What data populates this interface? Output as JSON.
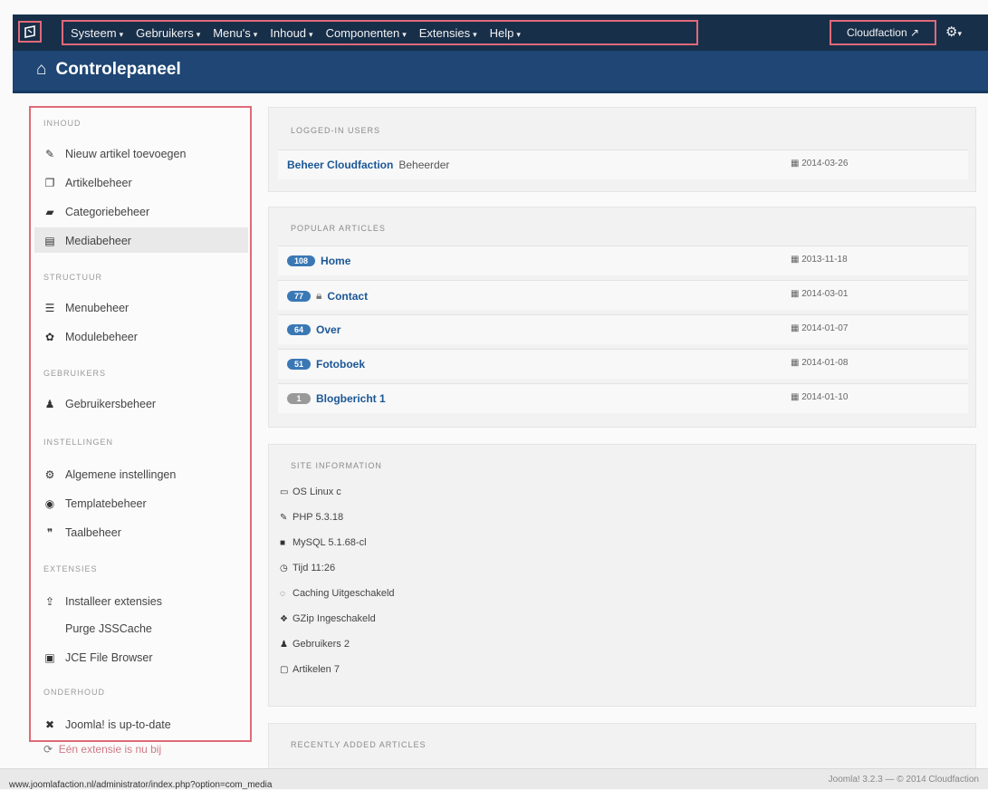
{
  "navbar": {
    "menu": [
      {
        "label": "Systeem"
      },
      {
        "label": "Gebruikers"
      },
      {
        "label": "Menu's"
      },
      {
        "label": "Inhoud"
      },
      {
        "label": "Componenten"
      },
      {
        "label": "Extensies"
      },
      {
        "label": "Help"
      }
    ],
    "site_link": "Cloudfaction",
    "caret": "▾"
  },
  "header": {
    "title": "Controlepaneel"
  },
  "sidebar": {
    "sections": [
      {
        "heading": "INHOUD",
        "items": [
          "Nieuw artikel toevoegen",
          "Artikelbeheer",
          "Categoriebeheer",
          "Mediabeheer"
        ]
      },
      {
        "heading": "STRUCTUUR",
        "items": [
          "Menubeheer",
          "Modulebeheer"
        ]
      },
      {
        "heading": "GEBRUIKERS",
        "items": [
          "Gebruikersbeheer"
        ]
      },
      {
        "heading": "INSTELLINGEN",
        "items": [
          "Algemene instellingen",
          "Templatebeheer",
          "Taalbeheer"
        ]
      },
      {
        "heading": "EXTENSIES",
        "items": [
          "Installeer extensies",
          "Purge JSSCache",
          "JCE File Browser"
        ]
      },
      {
        "heading": "ONDERHOUD",
        "items": [
          "Joomla! is up-to-date"
        ]
      }
    ],
    "below": "Eén extensie is nu bij"
  },
  "panels": {
    "logged": {
      "title": "LOGGED-IN USERS",
      "rows": [
        {
          "name": "Beheer Cloudfaction",
          "suffix": "Beheerder",
          "date": "2014-03-26"
        }
      ]
    },
    "popular": {
      "title": "POPULAR ARTICLES",
      "rows": [
        {
          "count": "108",
          "name": "Home",
          "date": "2013-11-18"
        },
        {
          "count": "77",
          "name": "Contact",
          "date": "2014-03-01"
        },
        {
          "count": "64",
          "name": "Over",
          "date": "2014-01-07"
        },
        {
          "count": "51",
          "name": "Fotoboek",
          "date": "2014-01-08"
        },
        {
          "count": "1",
          "name": "Blogbericht 1",
          "date": "2014-01-10"
        }
      ]
    },
    "site": {
      "title": "SITE INFORMATION",
      "lines": [
        {
          "icon": "monitor-icon",
          "glyph": "▭",
          "text": "OS Linux c"
        },
        {
          "icon": "wrench-icon",
          "glyph": "✎",
          "text": "PHP 5.3.18"
        },
        {
          "icon": "database-icon",
          "glyph": "■",
          "text": "MySQL 5.1.68-cl"
        },
        {
          "icon": "clock-icon",
          "glyph": "◷",
          "text": "Tijd 11:26"
        },
        {
          "icon": "cache-icon",
          "glyph": "◌",
          "text": "Caching Uitgeschakeld"
        },
        {
          "icon": "gzip-icon",
          "glyph": "❖",
          "text": "GZip Ingeschakeld"
        },
        {
          "icon": "user-icon",
          "glyph": "♟",
          "text": "Gebruikers 2"
        },
        {
          "icon": "file-icon",
          "glyph": "▢",
          "text": "Artikelen 7"
        }
      ]
    },
    "recent": {
      "title": "RECENTLY ADDED ARTICLES"
    }
  },
  "statusbar": {
    "url": "www.joomlafaction.nl/administrator/index.php?option=com_media",
    "version": "Joomla! 3.2.3 — © 2014 Cloudfaction"
  }
}
